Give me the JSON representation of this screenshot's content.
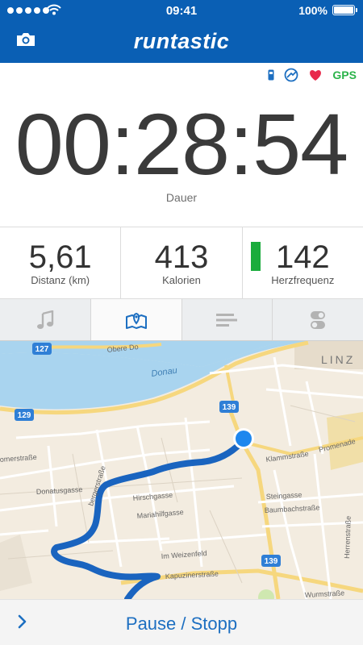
{
  "status_bar": {
    "time": "09:41",
    "battery": "100%",
    "signal_icon": "signal-dots-icon",
    "wifi_icon": "wifi-icon"
  },
  "header": {
    "brand": "runtastic",
    "camera_icon": "camera-icon"
  },
  "sensors": {
    "gps_label": "GPS",
    "icons": [
      "phone-sensor-icon",
      "speed-sensor-icon",
      "heart-icon"
    ]
  },
  "timer": {
    "value": "00:28:54",
    "label": "Dauer"
  },
  "stats": {
    "distance": {
      "value": "5,61",
      "label": "Distanz (km)"
    },
    "calories": {
      "value": "413",
      "label": "Kalorien"
    },
    "heart_rate": {
      "value": "142",
      "label": "Herzfrequenz"
    }
  },
  "tabs": [
    {
      "icon": "music-note-icon",
      "active": false
    },
    {
      "icon": "map-icon",
      "active": true
    },
    {
      "icon": "list-icon",
      "active": false
    },
    {
      "icon": "settings-toggle-icon",
      "active": false
    }
  ],
  "map": {
    "river_label": "Donau",
    "city_label": "LINZ",
    "route_shields": [
      "127",
      "129",
      "139",
      "139"
    ],
    "streets": [
      "Obere Do",
      "omerstraße",
      "Donatusgasse",
      "Hirschgasse",
      "Mariahilfgasse",
      "bergerstraße",
      "Klammstraße",
      "Promenade",
      "Steingasse",
      "Baumbachstraße",
      "Im Weizenfeld",
      "Kapuzinerstraße",
      "Wurmstraße",
      "Herrenstraße"
    ]
  },
  "bottom_bar": {
    "action_label": "Pause / Stopp",
    "chevron_icon": "chevron-right-icon"
  },
  "colors": {
    "brand_blue": "#0a5fb4",
    "route_blue": "#1a64bf",
    "hr_green": "#1aac3c",
    "gps_green": "#2bb34a",
    "water": "#a9d4ef"
  }
}
